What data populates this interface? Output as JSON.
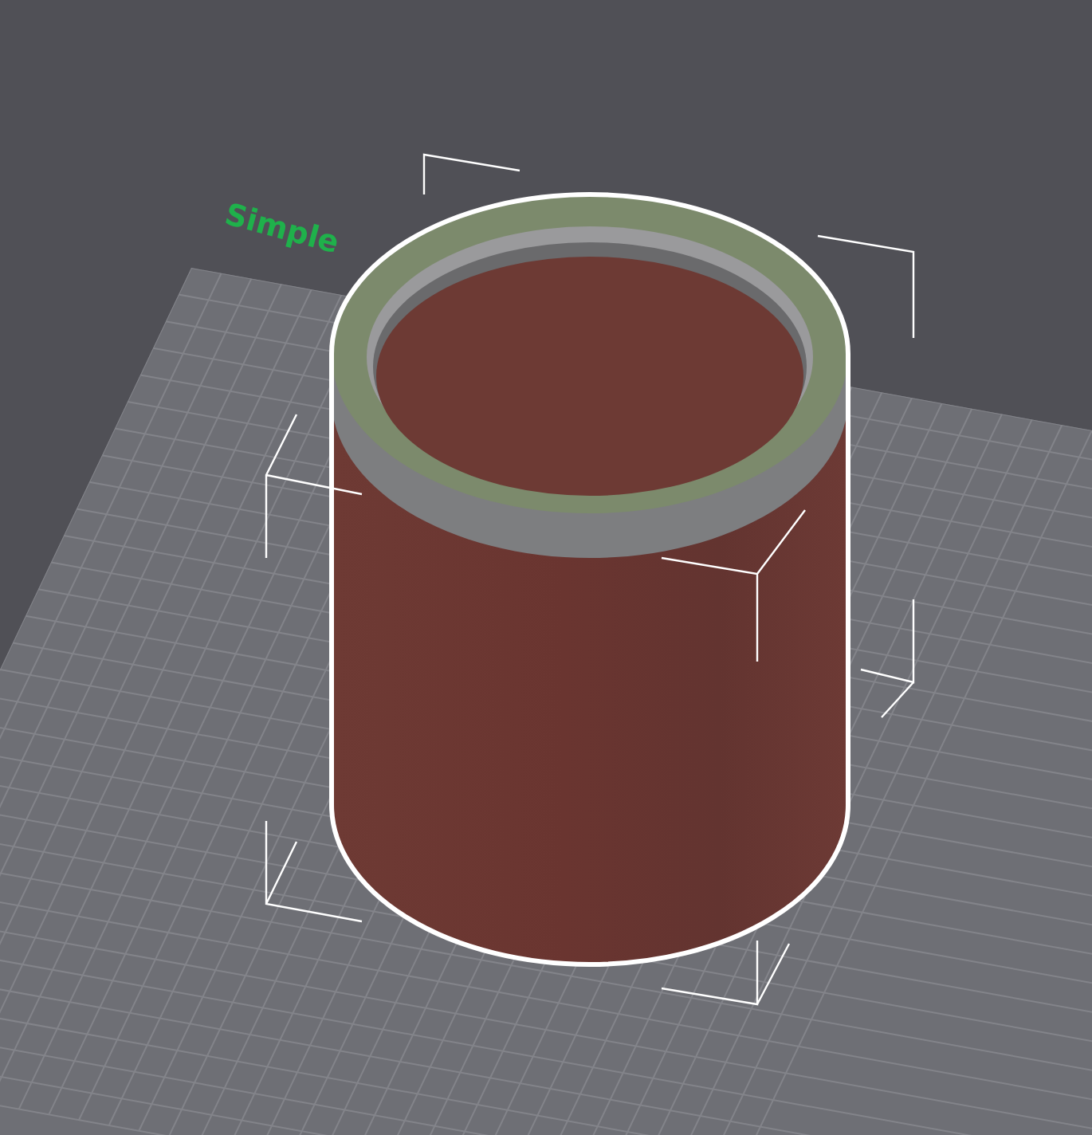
{
  "viewport": {
    "bed_label": "Simple",
    "object": {
      "selected": true
    }
  }
}
